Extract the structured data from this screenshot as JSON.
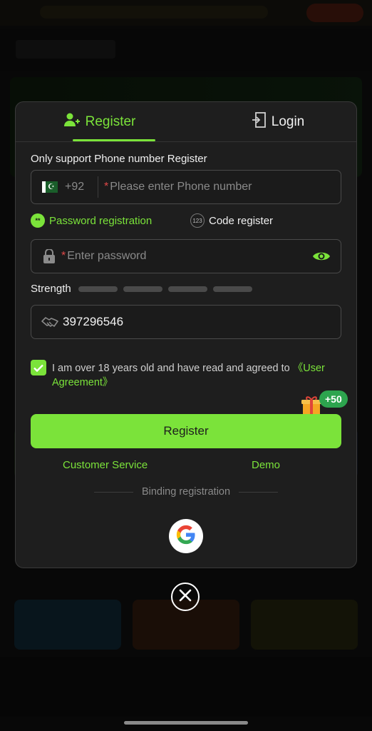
{
  "tabs": {
    "register_label": "Register",
    "login_label": "Login"
  },
  "form": {
    "support_label": "Only support Phone number Register",
    "phone": {
      "country_code": "+92",
      "required_mark": "*",
      "placeholder": "Please enter Phone number"
    },
    "options": {
      "password_registration": "Password registration",
      "code_register": "Code register",
      "code_icon_text": "123"
    },
    "password": {
      "required_mark": "*",
      "placeholder": "Enter password"
    },
    "strength_label": "Strength",
    "invite_code": "397296546",
    "agreement": {
      "checked": true,
      "text": "I am over 18 years old and have read and agreed to ",
      "link": "《User Agreement》"
    },
    "bonus_badge": "+50",
    "register_button": "Register"
  },
  "links": {
    "customer_service": "Customer Service",
    "demo": "Demo"
  },
  "binding_label": "Binding registration",
  "colors": {
    "accent": "#7be33a",
    "dialog_bg": "#1e1e1e",
    "required": "#e04848"
  },
  "icons": {
    "register_tab": "add-user-icon",
    "login_tab": "login-door-icon",
    "lock": "lock-icon",
    "eye": "eye-icon",
    "invite": "handshake-icon",
    "gift": "gift-icon",
    "google": "google-icon",
    "close": "close-icon"
  }
}
